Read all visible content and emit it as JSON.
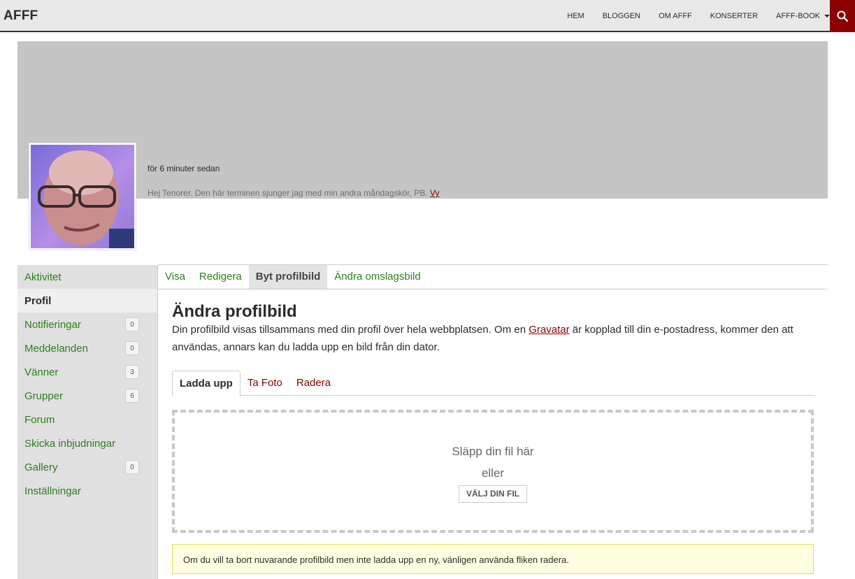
{
  "site": {
    "title": "AFFF"
  },
  "nav": {
    "items": [
      "HEM",
      "BLOGGEN",
      "OM AFFF",
      "KONSERTER",
      "AFFF-BOOK"
    ],
    "search_icon": "search-icon"
  },
  "profile": {
    "activity_time": "för 6 minuter sedan",
    "status_text": "Hej Tenorer. Den här terminen sjunger jag med min andra måndagskör, PB. ",
    "status_link": "Vy"
  },
  "sidebar": {
    "items": [
      {
        "label": "Aktivitet",
        "count": null,
        "active": false
      },
      {
        "label": "Profil",
        "count": null,
        "active": true
      },
      {
        "label": "Notifieringar",
        "count": "0",
        "active": false
      },
      {
        "label": "Meddelanden",
        "count": "0",
        "active": false
      },
      {
        "label": "Vänner",
        "count": "3",
        "active": false
      },
      {
        "label": "Grupper",
        "count": "6",
        "active": false
      },
      {
        "label": "Forum",
        "count": null,
        "active": false
      },
      {
        "label": "Skicka inbjudningar",
        "count": null,
        "active": false
      },
      {
        "label": "Gallery",
        "count": "0",
        "active": false
      },
      {
        "label": "Inställningar",
        "count": null,
        "active": false
      }
    ]
  },
  "subnav": {
    "items": [
      "Visa",
      "Redigera",
      "Byt profilbild",
      "Ändra omslagsbild"
    ],
    "active": "Byt profilbild"
  },
  "main": {
    "title": "Ändra profilbild",
    "intro_before": "Din profilbild visas tillsammans med din profil över hela webbplatsen. Om en ",
    "intro_link": "Gravatar",
    "intro_after": " är kopplad till din e-postadress, kommer den att användas, annars kan du ladda upp en bild från din dator.",
    "tabs": [
      "Ladda upp",
      "Ta Foto",
      "Radera"
    ],
    "drop_text": "Släpp din fil här",
    "or_text": "eller",
    "choose_button": "VÄLJ DIN FIL",
    "notice": "Om du vill ta bort nuvarande profilbild men inte ladda upp en ny, vänligen använda fliken radera."
  },
  "colors": {
    "accent": "#8b0000",
    "link_green": "#2e7d1e",
    "cover": "#c5c5c5"
  }
}
